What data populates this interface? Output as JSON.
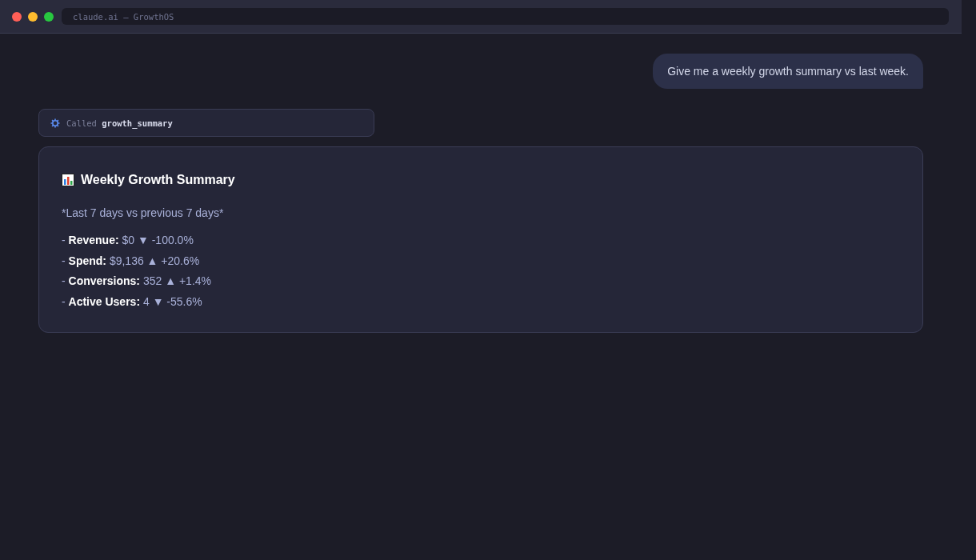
{
  "window": {
    "url": "claude.ai — GrowthOS"
  },
  "messages": [
    {
      "kind": "user",
      "text": "Give me a weekly growth summary vs last week."
    },
    {
      "kind": "tool_call",
      "text": "Called **growth_summary**"
    },
    {
      "kind": "card",
      "title": "Weekly Growth Summary",
      "subtitle": "*Last 7 days vs previous 7 days*",
      "lines": [
        "- **Revenue:** $0 ▼ -100.0%",
        "- **Spend:** $9,136 ▲ +20.6%",
        "- **Conversions:** 352 ▲ +1.4%",
        "- **Active Users:** 4 ▼ -55.6%"
      ]
    }
  ]
}
